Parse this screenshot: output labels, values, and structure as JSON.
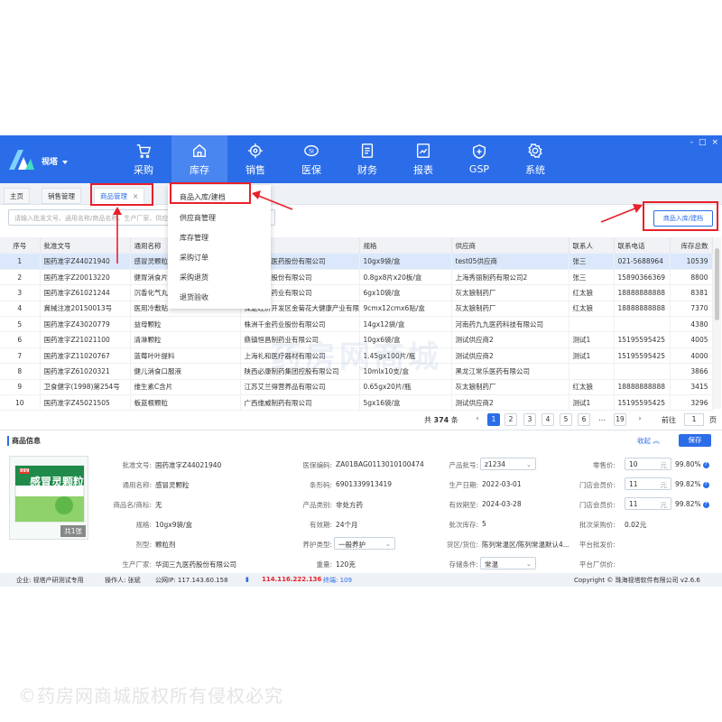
{
  "header": {
    "user": "视塔",
    "nav": [
      {
        "label": "采购",
        "icon": "cart-icon"
      },
      {
        "label": "库存",
        "icon": "home-icon",
        "active": true
      },
      {
        "label": "销售",
        "icon": "target-icon"
      },
      {
        "label": "医保",
        "icon": "si-icon"
      },
      {
        "label": "财务",
        "icon": "document-icon"
      },
      {
        "label": "报表",
        "icon": "chart-icon"
      },
      {
        "label": "GSP",
        "icon": "shield-plus-icon"
      },
      {
        "label": "系统",
        "icon": "gear-icon"
      }
    ],
    "window_controls": [
      "-",
      "□",
      "×"
    ]
  },
  "tabs": [
    "主页",
    "销售管理",
    "商品管理"
  ],
  "tab_close": "×",
  "search": {
    "placeholder": "请输入批准文号、通用名称/商品名称、生产厂家、供应商"
  },
  "add_button": "商品入库/建档",
  "dropdown": [
    "商品入库/建档",
    "供应商管理",
    "库存管理",
    "采购订单",
    "采购退货",
    "退货验收"
  ],
  "table": {
    "columns": [
      "序号",
      "批准文号",
      "通用名称",
      "",
      "规格",
      "供应商",
      "联系人",
      "联系电话",
      "库存总数"
    ],
    "rows": [
      [
        "1",
        "国药准字Z44021940",
        "感冒灵颗粒",
        "华润三九医药股份有限公司",
        "10gx9袋/盒",
        "test05供应商",
        "张三",
        "021-5688964",
        "10539"
      ],
      [
        "2",
        "国药准字Z20013220",
        "健胃消食片",
        "江中药业股份有限公司",
        "0.8gx8片x20板/盒",
        "上海秀丽制药有限公司2",
        "张三",
        "15890366369",
        "8800"
      ],
      [
        "3",
        "国药准字Z61021244",
        "沉香化气丸",
        "陕西香菊药业有限公司",
        "6gx10袋/盒",
        "灰太狼制药厂",
        "红太狼",
        "18888888888",
        "8381"
      ],
      [
        "4",
        "冀械注准20150013号",
        "医用冷敷贴",
        "保定经济开发区金菊花大健康产业有限公司",
        "9cmx12cmx6贴/盒",
        "灰太狼制药厂",
        "红太狼",
        "18888888888",
        "7370"
      ],
      [
        "5",
        "国药准字Z43020779",
        "益母颗粒",
        "株洲千金药业股份有限公司",
        "14gx12袋/盒",
        "河南药九九医药科技有限公司",
        "",
        "",
        "4380"
      ],
      [
        "6",
        "国药准字Z21021100",
        "清淋颗粒",
        "鼎镇恒昌制药业有限公司",
        "10gx6袋/盒",
        "测试供应商2",
        "测试1",
        "15195595425",
        "4005"
      ],
      [
        "7",
        "国药准字Z11020767",
        "蓝莓叶叶提料",
        "上海礼和医疗器材有限公司",
        "1.45gx100片/瓶",
        "测试供应商2",
        "测试1",
        "15195595425",
        "4000"
      ],
      [
        "8",
        "国药准字Z61020321",
        "健儿消食口服液",
        "陕西必康制药集团控股有限公司",
        "10mlx10支/盒",
        "黑龙江常乐医药有限公司",
        "",
        "",
        "3866"
      ],
      [
        "9",
        "卫食健字(1998)第254号",
        "维生素C含片",
        "江苏艾兰得营养品有限公司",
        "0.65gx20片/瓶",
        "灰太狼制药厂",
        "红太狼",
        "18888888888",
        "3415"
      ],
      [
        "10",
        "国药准字Z45021505",
        "板蓝根颗粒",
        "广西维威制药有限公司",
        "5gx16袋/盒",
        "测试供应商2",
        "测试1",
        "15195595425",
        "3296"
      ]
    ]
  },
  "watermark": "药房网商城",
  "pager": {
    "total_prefix": "共",
    "total": "374",
    "total_suffix": "条",
    "prev": "‹",
    "pages": [
      "1",
      "2",
      "3",
      "4",
      "5",
      "6",
      "...",
      "19"
    ],
    "next": "›",
    "goto": "前往",
    "goto_value": "1",
    "page_suffix": "页"
  },
  "info": {
    "title": "商品信息",
    "collapse": "收起",
    "save": "保存",
    "image_count": "共1张",
    "image_text": "感冒灵颗粒",
    "image_brand": "999",
    "fields": {
      "approval_label": "批准文号:",
      "approval": "国药准字Z44021940",
      "generic_label": "通用名称:",
      "generic": "感冒灵颗粒",
      "brand_label": "商品名/商标:",
      "brand": "无",
      "spec_label": "规格:",
      "spec": "10gx9袋/盒",
      "form_label": "剂型:",
      "form": "颗粒剂",
      "maker_label": "生产厂家:",
      "maker": "华润三九医药股份有限公司",
      "insurance_label": "医保编码:",
      "insurance": "ZA01BAG0113010100474",
      "barcode_label": "条形码:",
      "barcode": "6901339913419",
      "category_label": "产品类别:",
      "category": "非处方药",
      "validity_label": "有效期:",
      "validity": "24个月",
      "maint_label": "养护类型:",
      "maint": "一般养护",
      "weight_label": "重量:",
      "weight": "120克",
      "batch_label": "产品批号:",
      "batch": "z1234",
      "prod_date_label": "生产日期:",
      "prod_date": "2022-03-01",
      "expiry_label": "有效期至:",
      "expiry": "2024-03-28",
      "batch_stock_label": "批次库存:",
      "batch_stock": "5",
      "location_label": "货区/货位:",
      "location": "陈列常温区/陈列常温默认4...",
      "storage_label": "存储条件:",
      "storage": "常温",
      "retail_label": "零售价:",
      "retail": "10",
      "retail_pct": "99.80%",
      "member_label": "门店会员价:",
      "member": "11",
      "member_pct": "99.82%",
      "store_member_label": "门店会员价:",
      "store_member": "11",
      "store_member_pct": "99.82%",
      "batch_cost_label": "批次采购价:",
      "batch_cost": "0.02元",
      "platform_label": "平台批发价:",
      "platform": "",
      "platform_supply_label": "平台厂供价:",
      "platform_supply": "",
      "unit": "元"
    }
  },
  "status": {
    "company": "企业: 视塔产研测试专用",
    "operator": "操作人: 张斌",
    "public_ip": "公网IP: 117.143.60.158",
    "private_ip": "114.116.222.136",
    "terminal": "终端: 109",
    "copyright": "Copyright © 珠海视塔软件有限公司 v2.6.6"
  },
  "image_copyright": "©药房网商城版权所有侵权必究",
  "colors": {
    "primary": "#2b6de8",
    "highlight": "#e8202a",
    "selected_row": "#dbe8fc"
  }
}
